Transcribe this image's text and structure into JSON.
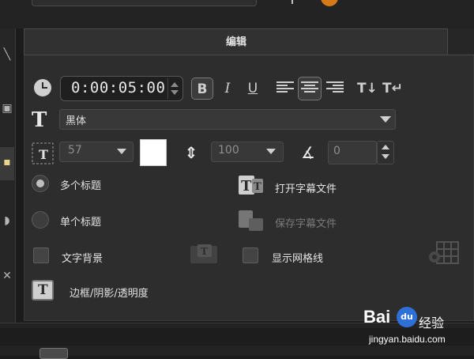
{
  "panel": {
    "title": "编辑"
  },
  "time": {
    "value": "0:00:05:00"
  },
  "format": {
    "bold_glyph": "B",
    "italic_glyph": "I",
    "underline_glyph": "U",
    "text_dir_1": "T↓",
    "text_dir_2": "T↵"
  },
  "font": {
    "selected": "黑体"
  },
  "size": {
    "value": "57"
  },
  "color": {
    "swatch": "#ffffff"
  },
  "line_spacing": {
    "value": "100"
  },
  "angle": {
    "value": "0"
  },
  "options": {
    "multi_title": "多个标题",
    "single_title": "单个标题",
    "open_subtitle": "打开字幕文件",
    "save_subtitle": "保存字幕文件",
    "text_background": "文字背景",
    "show_grid": "显示网格线",
    "border_shadow": "边框/阴影/透明度",
    "multi_selected": true
  },
  "watermark": {
    "brand": "Bai",
    "paw": "du",
    "suffix": "经验",
    "url": "jingyan.baidu.com"
  },
  "icons": {
    "clock": "clock-icon",
    "font_type": "font-type-icon",
    "font_size": "font-size-icon",
    "line_spacing": "line-spacing-icon",
    "angle": "angle-icon",
    "open_subtitle": "open-subtitle-icon",
    "save_subtitle": "save-subtitle-icon",
    "grid": "grid-icon",
    "border": "border-icon"
  },
  "colors": {
    "background": "#2d2d2d",
    "accent_orange": "#d47a19"
  }
}
